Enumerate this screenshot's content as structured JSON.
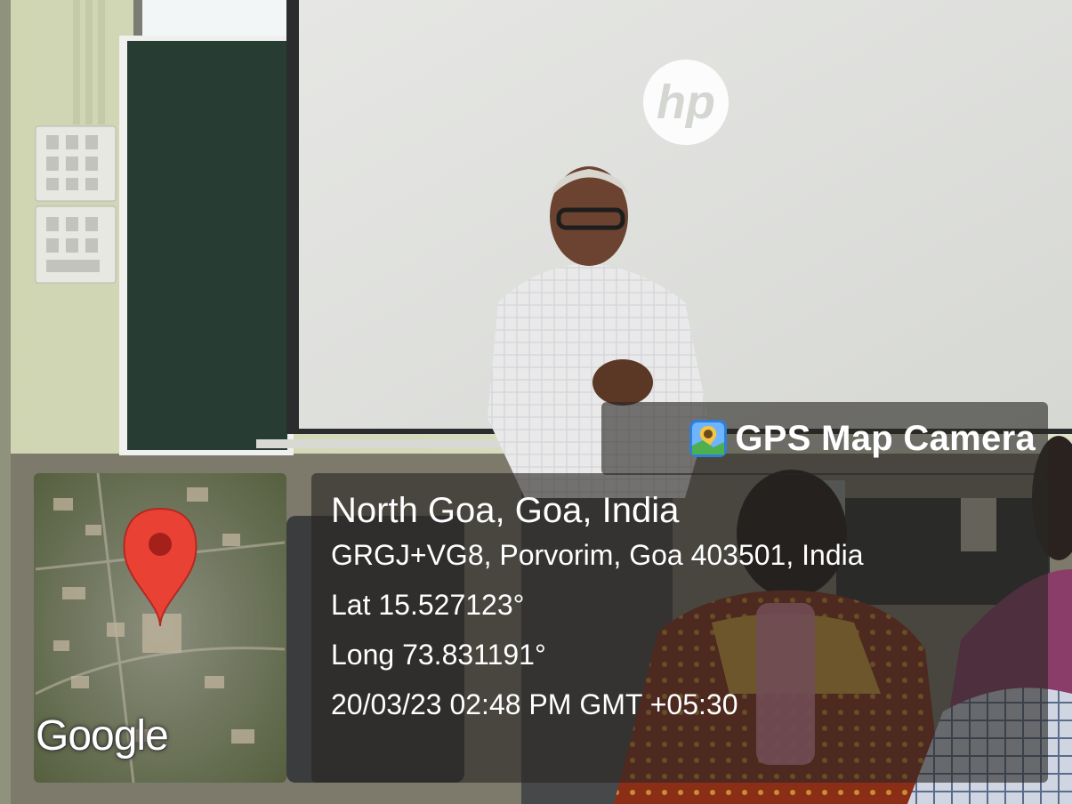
{
  "badge": {
    "label": "GPS Map Camera",
    "icon": "camera-pin-icon"
  },
  "location": {
    "place": "North Goa, Goa, India",
    "address": "GRGJ+VG8, Porvorim, Goa 403501, India",
    "latitude": "Lat 15.527123°",
    "longitude": "Long 73.831191°",
    "timestamp": "20/03/23 02:48 PM GMT +05:30"
  },
  "map": {
    "provider_label": "Google",
    "marker_icon": "map-pin-icon"
  },
  "scene": {
    "projector_logo": "hp"
  },
  "colors": {
    "overlay": "#282624",
    "marker": "#e94235",
    "marker_dot": "#a5201a"
  }
}
